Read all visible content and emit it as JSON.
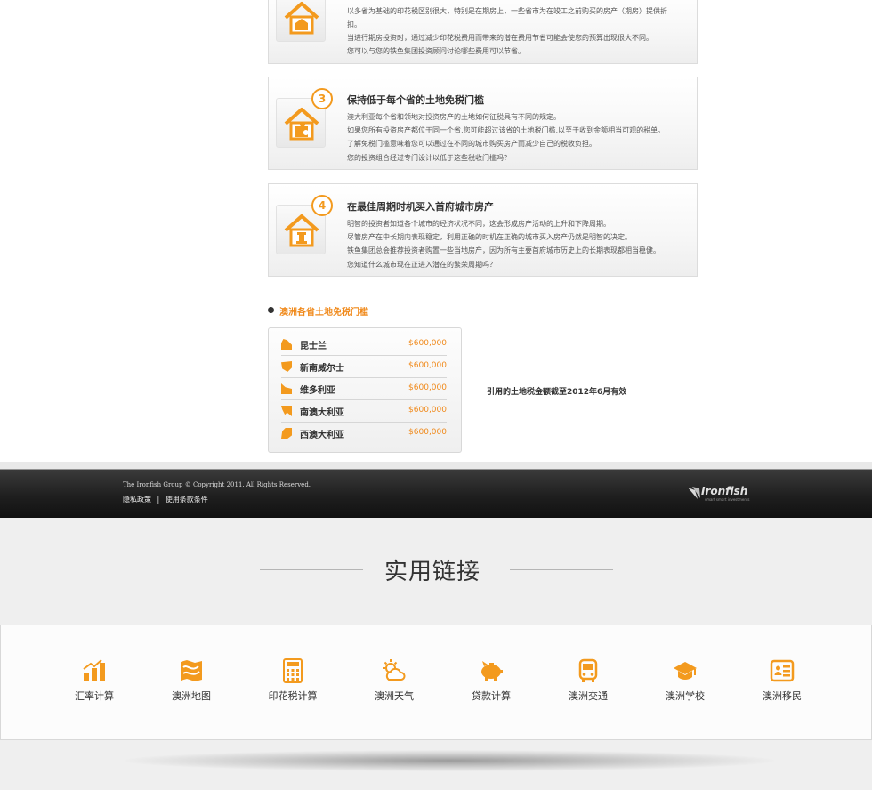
{
  "tips": [
    {
      "number": "",
      "title": "",
      "lines": [
        "以多省为基础的印花税区别很大，特别是在期房上，一些省市为在竣工之前购买的房产（期房）提供折",
        "扣。",
        "当进行期房投资时，通过减少印花税费用而带来的潜在费用节省可能会使您的预算出现很大不同。",
        "您可以与您的铁鱼集团投资顾问讨论哪些费用可以节省。"
      ]
    },
    {
      "number": "3",
      "title": "保持低于每个省的土地免税门槛",
      "lines": [
        "澳大利亚每个省和领地对投资房产的土地如何征税具有不同的规定。",
        "如果您所有投资房产都位于同一个省,您可能超过该省的土地税门槛,以至于收到金额相当可观的税单。",
        "了解免税门槛意味着您可以通过在不同的城市购买房产而减少自己的税收负担。",
        "您的投资组合经过专门设计以低于这些税收门槛吗？"
      ]
    },
    {
      "number": "4",
      "title": "在最佳周期时机买入首府城市房产",
      "lines": [
        "明智的投资者知道各个城市的经济状况不同，这会形成房产活动的上升和下降周期。",
        "尽管房产在中长期内表现稳定，利用正确的时机在正确的城市买入房产仍然是明智的决定。",
        "铁鱼集团总会推荐投资者购置一些当地房产，因为所有主要首府城市历史上的长期表现都相当稳健。",
        "您知道什么城市现在正进入潜在的繁荣周期吗？"
      ]
    }
  ],
  "tax_section": {
    "title": "澳洲各省土地免税门槛",
    "rows": [
      {
        "state": "昆士兰",
        "value": "$600,000"
      },
      {
        "state": "新南威尔士",
        "value": "$600,000"
      },
      {
        "state": "维多利亚",
        "value": "$600,000"
      },
      {
        "state": "南澳大利亚",
        "value": "$600,000"
      },
      {
        "state": "西澳大利亚",
        "value": "$600,000"
      }
    ],
    "note": "引用的土地税金额截至2012年6月有效"
  },
  "footer": {
    "copyright": "The Ironfish Group © Copyright 2011. All Rights Reserved.",
    "privacy_link": "隐私政策",
    "separator": "|",
    "terms_link": "使用条款条件",
    "logo_text": "Ironfish",
    "logo_tagline": "smart smart investments"
  },
  "useful_links": {
    "title": "实用链接",
    "items": [
      {
        "label": "汇率计算",
        "icon": "bar-chart-icon"
      },
      {
        "label": "澳洲地图",
        "icon": "map-icon"
      },
      {
        "label": "印花税计算",
        "icon": "calculator-icon"
      },
      {
        "label": "澳洲天气",
        "icon": "weather-icon"
      },
      {
        "label": "贷款计算",
        "icon": "piggy-bank-icon"
      },
      {
        "label": "澳洲交通",
        "icon": "bus-icon"
      },
      {
        "label": "澳洲学校",
        "icon": "graduation-cap-icon"
      },
      {
        "label": "澳洲移民",
        "icon": "id-card-icon"
      }
    ]
  },
  "colors": {
    "accent": "#f39a1e",
    "footer_bg": "#1e1e1e"
  }
}
